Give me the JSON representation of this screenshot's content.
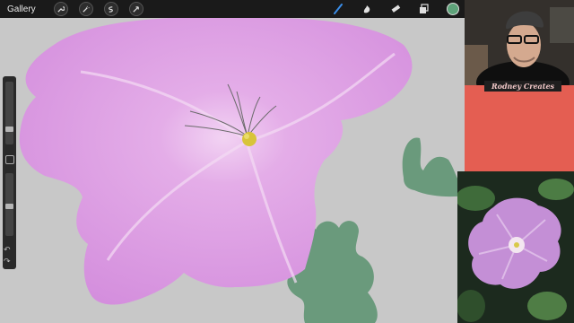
{
  "toolbar": {
    "gallery_label": "Gallery",
    "left_tools": [
      "wrench-icon",
      "magic-wand-icon",
      "selection-icon",
      "transform-icon"
    ],
    "right_tools": [
      "brush-icon",
      "smudge-icon",
      "eraser-icon",
      "layers-icon"
    ],
    "active_tool": "brush-icon",
    "current_color": "#5ea37a"
  },
  "webcam": {
    "caption": "Rodney Creates",
    "background_color": "#e45e52"
  },
  "canvas": {
    "background_color": "#c8c8c8",
    "petal_color": "#d58fdf",
    "leaf_color": "#6a9a7c",
    "stamen_color": "#d8c43a"
  }
}
